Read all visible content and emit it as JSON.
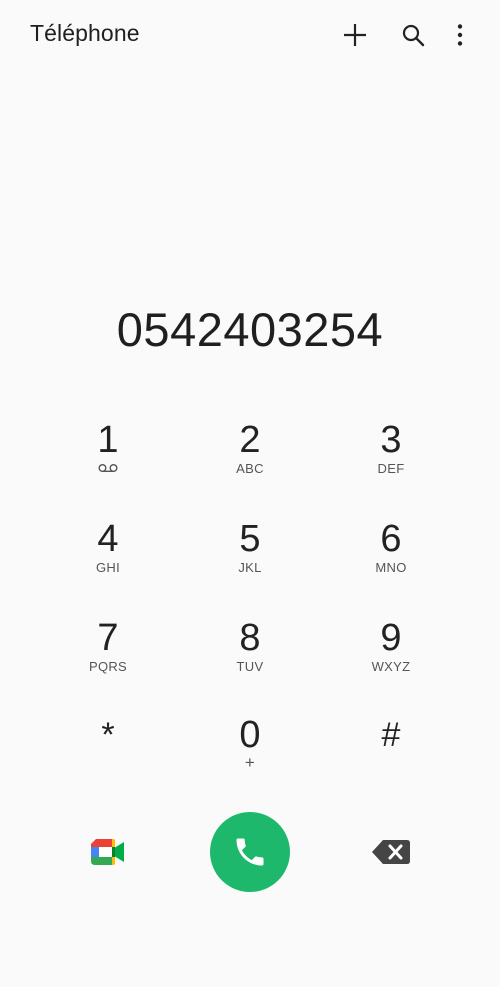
{
  "header": {
    "title": "Téléphone",
    "icons": [
      "plus-icon",
      "search-icon",
      "more-vert-icon"
    ]
  },
  "dialer": {
    "number": "0542403254",
    "keys": [
      {
        "digit": "1",
        "letters": "",
        "icon": "voicemail-icon"
      },
      {
        "digit": "2",
        "letters": "ABC"
      },
      {
        "digit": "3",
        "letters": "DEF"
      },
      {
        "digit": "4",
        "letters": "GHI"
      },
      {
        "digit": "5",
        "letters": "JKL"
      },
      {
        "digit": "6",
        "letters": "MNO"
      },
      {
        "digit": "7",
        "letters": "PQRS"
      },
      {
        "digit": "8",
        "letters": "TUV"
      },
      {
        "digit": "9",
        "letters": "WXYZ"
      },
      {
        "digit": "*",
        "letters": ""
      },
      {
        "digit": "0",
        "letters": "+"
      },
      {
        "digit": "#",
        "letters": ""
      }
    ]
  },
  "actions": {
    "video_icon": "google-meet-icon",
    "call_icon": "phone-icon",
    "backspace_icon": "backspace-icon",
    "call_color": "#1db86b"
  }
}
